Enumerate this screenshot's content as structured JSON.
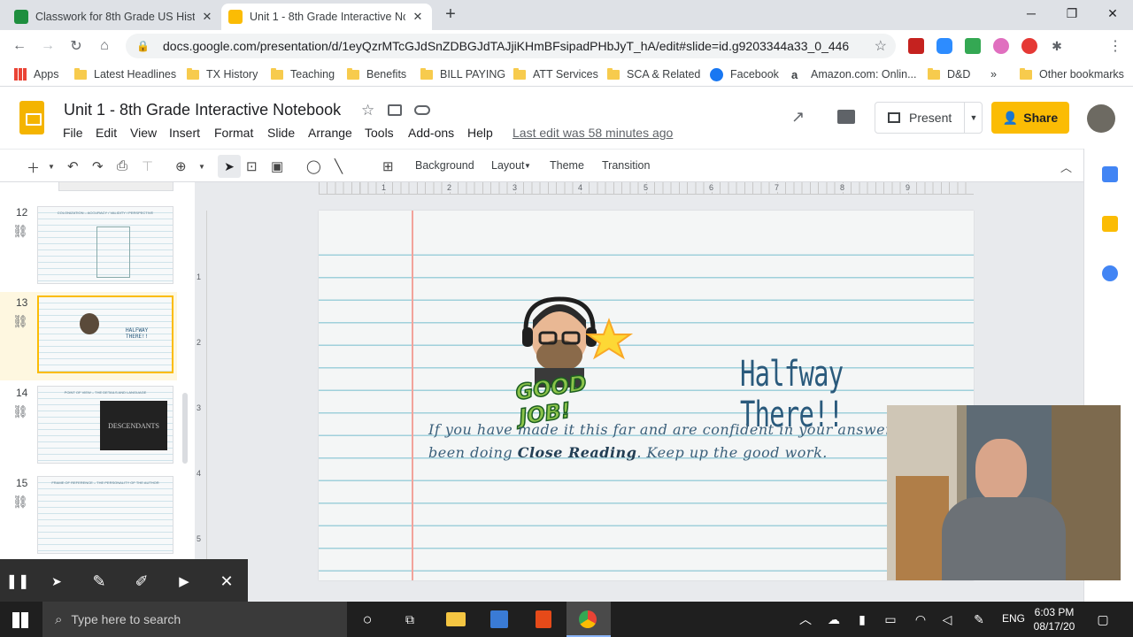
{
  "browser": {
    "tabs": [
      {
        "title": "Classwork for 8th Grade US Histo",
        "favicon": "classroom-icon",
        "active": false
      },
      {
        "title": "Unit 1 - 8th Grade Interactive No",
        "favicon": "slides-icon",
        "active": true
      }
    ],
    "new_tab": "+",
    "url": "docs.google.com/presentation/d/1eyQzrMTcGJdSnZDBGJdTAJjiKHmBFsipadPHbJyT_hA/edit#slide=id.g9203344a33_0_446",
    "bookmarks": [
      "Apps",
      "Latest Headlines",
      "TX History",
      "Teaching",
      "Benefits",
      "BILL PAYING",
      "ATT Services",
      "SCA & Related",
      "Facebook",
      "Amazon.com: Onlin...",
      "D&D"
    ],
    "bookmarks_more": "»",
    "other_bookmarks": "Other bookmarks"
  },
  "docs": {
    "title": "Unit 1 - 8th Grade Interactive Notebook",
    "menus": [
      "File",
      "Edit",
      "View",
      "Insert",
      "Format",
      "Slide",
      "Arrange",
      "Tools",
      "Add-ons",
      "Help"
    ],
    "last_edit": "Last edit was 58 minutes ago",
    "present_label": "Present",
    "share_label": "Share",
    "toolbar_text": [
      "Background",
      "Layout",
      "Theme",
      "Transition"
    ]
  },
  "filmstrip": {
    "slides": [
      {
        "number": "12",
        "thumb_title": "COLONIZATION – ACCURACY / VALIDITY / PERSPECTIVE"
      },
      {
        "number": "13",
        "thumb_title": "HALFWAY THERE!!",
        "selected": true
      },
      {
        "number": "14",
        "thumb_title": "POINT OF VIEW – THE DETAILS AND LANGUAGE",
        "thumb_image_text": "DESCENDANTS"
      },
      {
        "number": "15",
        "thumb_title": "FRAME OF REFERENCE – THE PERSONALITY OF THE AUTHOR"
      }
    ]
  },
  "ruler": [
    "1",
    "2",
    "3",
    "4",
    "5",
    "6",
    "7",
    "8",
    "9"
  ],
  "vruler": [
    "1",
    "2",
    "3",
    "4",
    "5"
  ],
  "slide": {
    "sticker_text": "GOOD JOB!",
    "heading": "Halfway There!!",
    "line1": "If you have made it this far and are confident in your answers, you",
    "line2_pre": "been doing ",
    "line2_bold": "Close Reading",
    "line2_post": ". Keep up the good work."
  },
  "taskbar": {
    "search_placeholder": "Type here to search",
    "language": "ENG",
    "time": "6:03 PM",
    "date": "08/17/20"
  },
  "colors": {
    "docs_yellow": "#fbbc04",
    "slide_heading": "#2a5a7c",
    "slide_text": "#3a5f7a"
  }
}
